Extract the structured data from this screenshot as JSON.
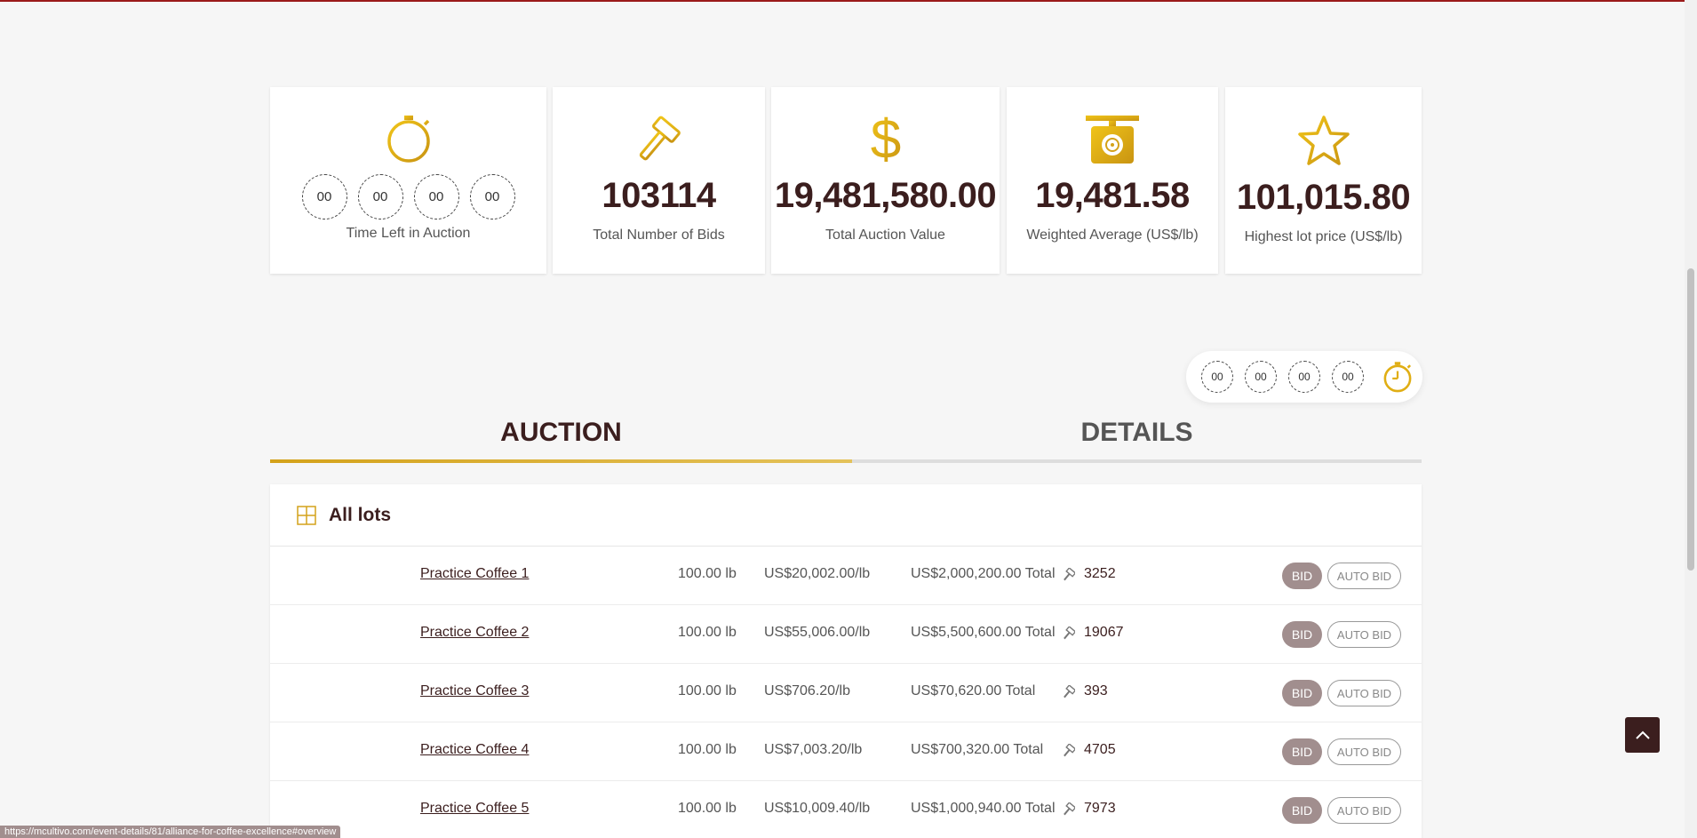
{
  "colors": {
    "accent": "#d4a21a",
    "brand": "#3b1e1e",
    "bid_button": "#a18e8e"
  },
  "stats": {
    "timer": {
      "icon": "stopwatch-icon",
      "values": [
        "00",
        "00",
        "00",
        "00"
      ],
      "label": "Time Left in Auction"
    },
    "bids": {
      "icon": "gavel-icon",
      "value": "103114",
      "label": "Total Number of Bids"
    },
    "value": {
      "icon": "dollar-icon",
      "value": "19,481,580.00",
      "label": "Total Auction Value"
    },
    "average": {
      "icon": "scale-icon",
      "value": "19,481.58",
      "label": "Weighted Average (US$/lb)"
    },
    "highest": {
      "icon": "star-icon",
      "value": "101,015.80",
      "label": "Highest lot price (US$/lb)"
    }
  },
  "mini_timer": {
    "values": [
      "00",
      "00",
      "00",
      "00"
    ],
    "icon": "stopwatch-icon"
  },
  "tabs": [
    {
      "label": "AUCTION",
      "active": true
    },
    {
      "label": "DETAILS",
      "active": false
    }
  ],
  "lots_panel": {
    "title": "All lots",
    "icon": "grid-icon",
    "bid_label": "BID",
    "auto_bid_label": "AUTO BID",
    "rows": [
      {
        "name": "Practice Coffee 1",
        "weight": "100.00 lb",
        "price": "US$20,002.00/lb",
        "total": "US$2,000,200.00 Total",
        "bids": "3252"
      },
      {
        "name": "Practice Coffee 2",
        "weight": "100.00 lb",
        "price": "US$55,006.00/lb",
        "total": "US$5,500,600.00 Total",
        "bids": "19067"
      },
      {
        "name": "Practice Coffee 3",
        "weight": "100.00 lb",
        "price": "US$706.20/lb",
        "total": "US$70,620.00 Total",
        "bids": "393"
      },
      {
        "name": "Practice Coffee 4",
        "weight": "100.00 lb",
        "price": "US$7,003.20/lb",
        "total": "US$700,320.00 Total",
        "bids": "4705"
      },
      {
        "name": "Practice Coffee 5",
        "weight": "100.00 lb",
        "price": "US$10,009.40/lb",
        "total": "US$1,000,940.00 Total",
        "bids": "7973"
      }
    ]
  },
  "back_to_top_icon": "chevron-up-icon",
  "status_url": "https://mcultivo.com/event-details/81/alliance-for-coffee-excellence#overview"
}
